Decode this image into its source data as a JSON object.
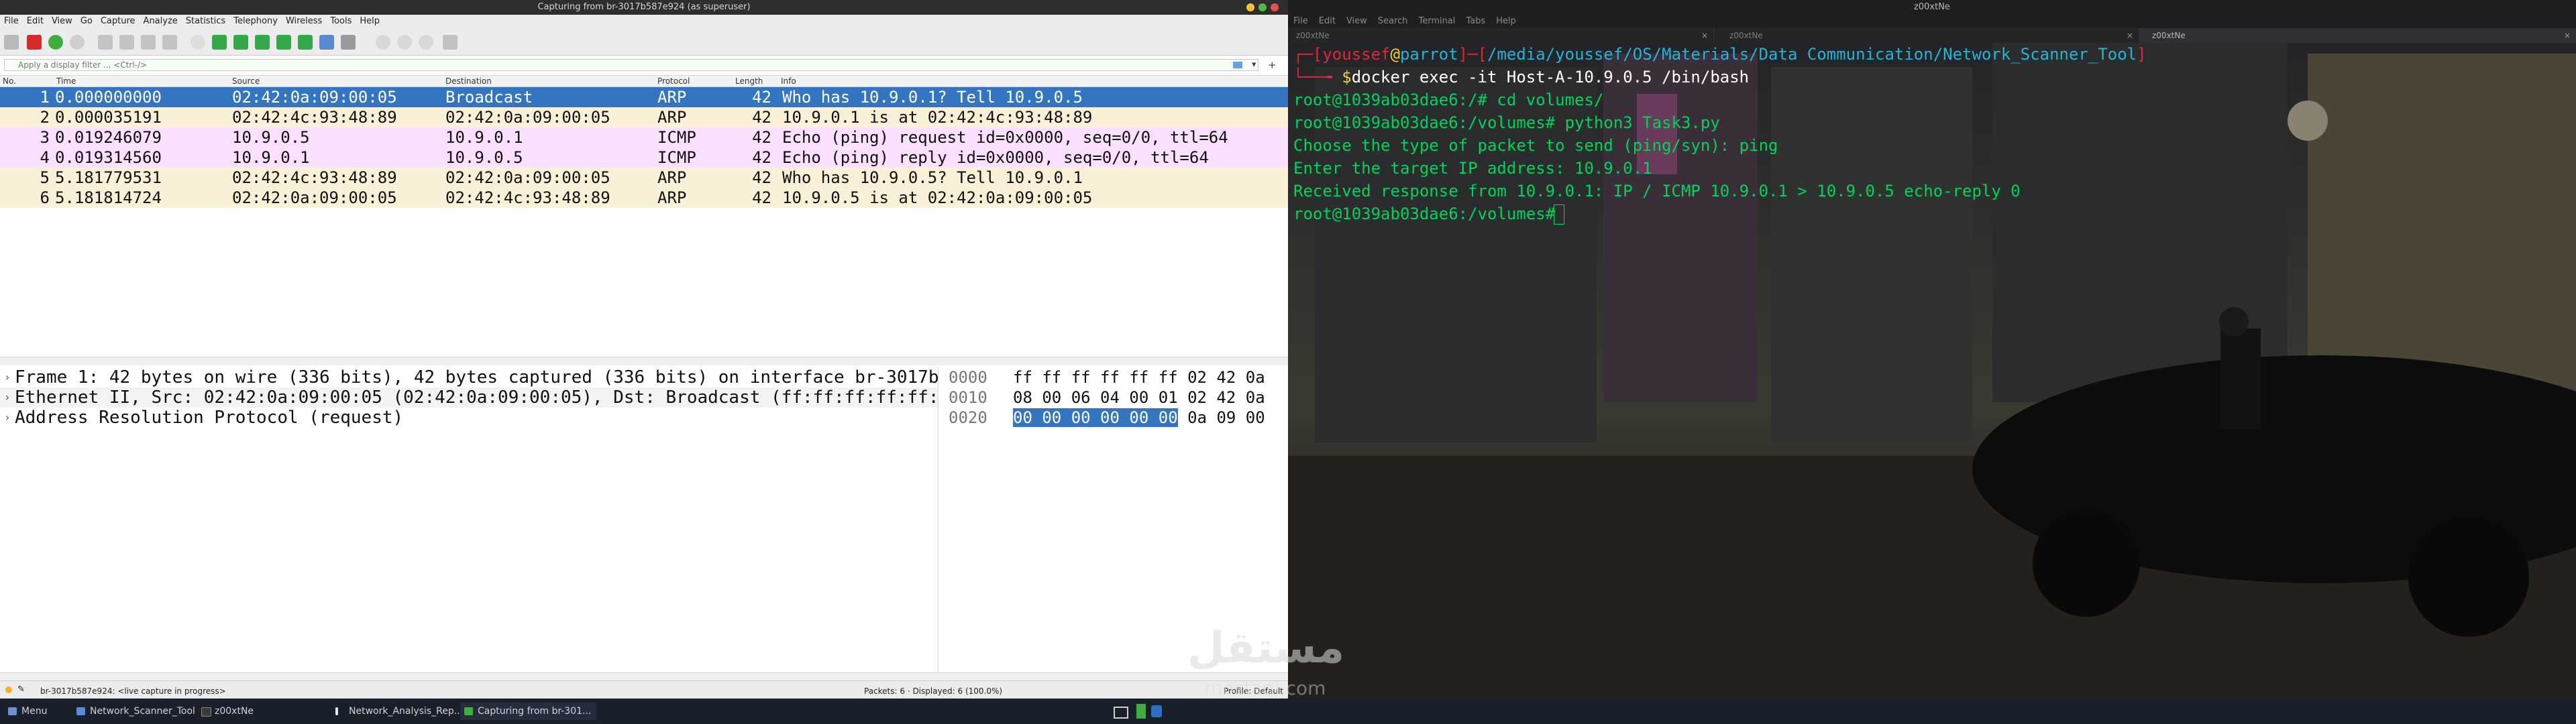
{
  "wireshark": {
    "title": "Capturing from br-3017b587e924 (as superuser)",
    "menu": [
      "File",
      "Edit",
      "View",
      "Go",
      "Capture",
      "Analyze",
      "Statistics",
      "Telephony",
      "Wireless",
      "Tools",
      "Help"
    ],
    "filter_placeholder": "Apply a display filter ... <Ctrl-/>",
    "columns": {
      "no": "No.",
      "time": "Time",
      "source": "Source",
      "destination": "Destination",
      "protocol": "Protocol",
      "length": "Length",
      "info": "Info"
    },
    "packets": [
      {
        "no": "1",
        "time": "0.000000000",
        "source": "02:42:0a:09:00:05",
        "destination": "Broadcast",
        "protocol": "ARP",
        "length": "42",
        "info": "Who has 10.9.0.1? Tell 10.9.0.5"
      },
      {
        "no": "2",
        "time": "0.000035191",
        "source": "02:42:4c:93:48:89",
        "destination": "02:42:0a:09:00:05",
        "protocol": "ARP",
        "length": "42",
        "info": "10.9.0.1 is at 02:42:4c:93:48:89"
      },
      {
        "no": "3",
        "time": "0.019246079",
        "source": "10.9.0.5",
        "destination": "10.9.0.1",
        "protocol": "ICMP",
        "length": "42",
        "info": "Echo (ping) request  id=0x0000, seq=0/0, ttl=64"
      },
      {
        "no": "4",
        "time": "0.019314560",
        "source": "10.9.0.1",
        "destination": "10.9.0.5",
        "protocol": "ICMP",
        "length": "42",
        "info": "Echo (ping) reply    id=0x0000, seq=0/0, ttl=64"
      },
      {
        "no": "5",
        "time": "5.181779531",
        "source": "02:42:4c:93:48:89",
        "destination": "02:42:0a:09:00:05",
        "protocol": "ARP",
        "length": "42",
        "info": "Who has 10.9.0.5? Tell 10.9.0.1"
      },
      {
        "no": "6",
        "time": "5.181814724",
        "source": "02:42:0a:09:00:05",
        "destination": "02:42:4c:93:48:89",
        "protocol": "ARP",
        "length": "42",
        "info": "10.9.0.5 is at 02:42:0a:09:00:05"
      }
    ],
    "details": [
      "Frame 1: 42 bytes on wire (336 bits), 42 bytes captured (336 bits) on interface br-3017b",
      "Ethernet II, Src: 02:42:0a:09:00:05 (02:42:0a:09:00:05), Dst: Broadcast (ff:ff:ff:ff:ff:",
      "Address Resolution Protocol (request)"
    ],
    "bytes": [
      {
        "offset": "0000",
        "hex": "ff ff ff ff ff ff 02 42  0a"
      },
      {
        "offset": "0010",
        "hex": "08 00 06 04 00 01 02 42  0a"
      },
      {
        "offset": "0020",
        "hex_sel": "00 00 00 00 00 00",
        "hex": " 0a 09  00"
      }
    ],
    "status_left": "br-3017b587e924: <live capture in progress>",
    "status_mid": "Packets: 6 · Displayed: 6 (100.0%)",
    "status_right": "Profile: Default"
  },
  "terminal": {
    "title": "z00xtNe",
    "menu": [
      "File",
      "Edit",
      "View",
      "Search",
      "Terminal",
      "Tabs",
      "Help"
    ],
    "tabs": [
      "z00xtNe",
      "z00xtNe",
      "z00xtNe"
    ],
    "prompt_user": "youssef",
    "prompt_at": "@",
    "prompt_host": "parrot",
    "prompt_path": "/media/youssef/OS/Materials/Data Communication/Network_Scanner_Tool",
    "cmd1": "docker exec -it Host-A-10.9.0.5 /bin/bash",
    "lines": [
      "root@1039ab03dae6:/# cd volumes/",
      "root@1039ab03dae6:/volumes# python3 Task3.py",
      "Choose the type of packet to send (ping/syn): ping",
      "Enter the target IP address: 10.9.0.1",
      "Received response from 10.9.0.1: IP / ICMP 10.9.0.1 > 10.9.0.5 echo-reply 0",
      "root@1039ab03dae6:/volumes# "
    ]
  },
  "taskbar": {
    "menu": "Menu",
    "tasks": [
      "Network_Scanner_Tool",
      "z00xtNe",
      "Network_Analysis_Rep...",
      "Capturing from br-301..."
    ]
  },
  "watermark": {
    "text": "مستقل",
    "sub": "mostaql.com"
  },
  "colors": {
    "arp_row": "#faf0d7",
    "icmp_row": "#fce0ff",
    "selected_row": "#3475c1",
    "terminal_green": "#00d35c",
    "prompt_red": "#e0263a"
  }
}
